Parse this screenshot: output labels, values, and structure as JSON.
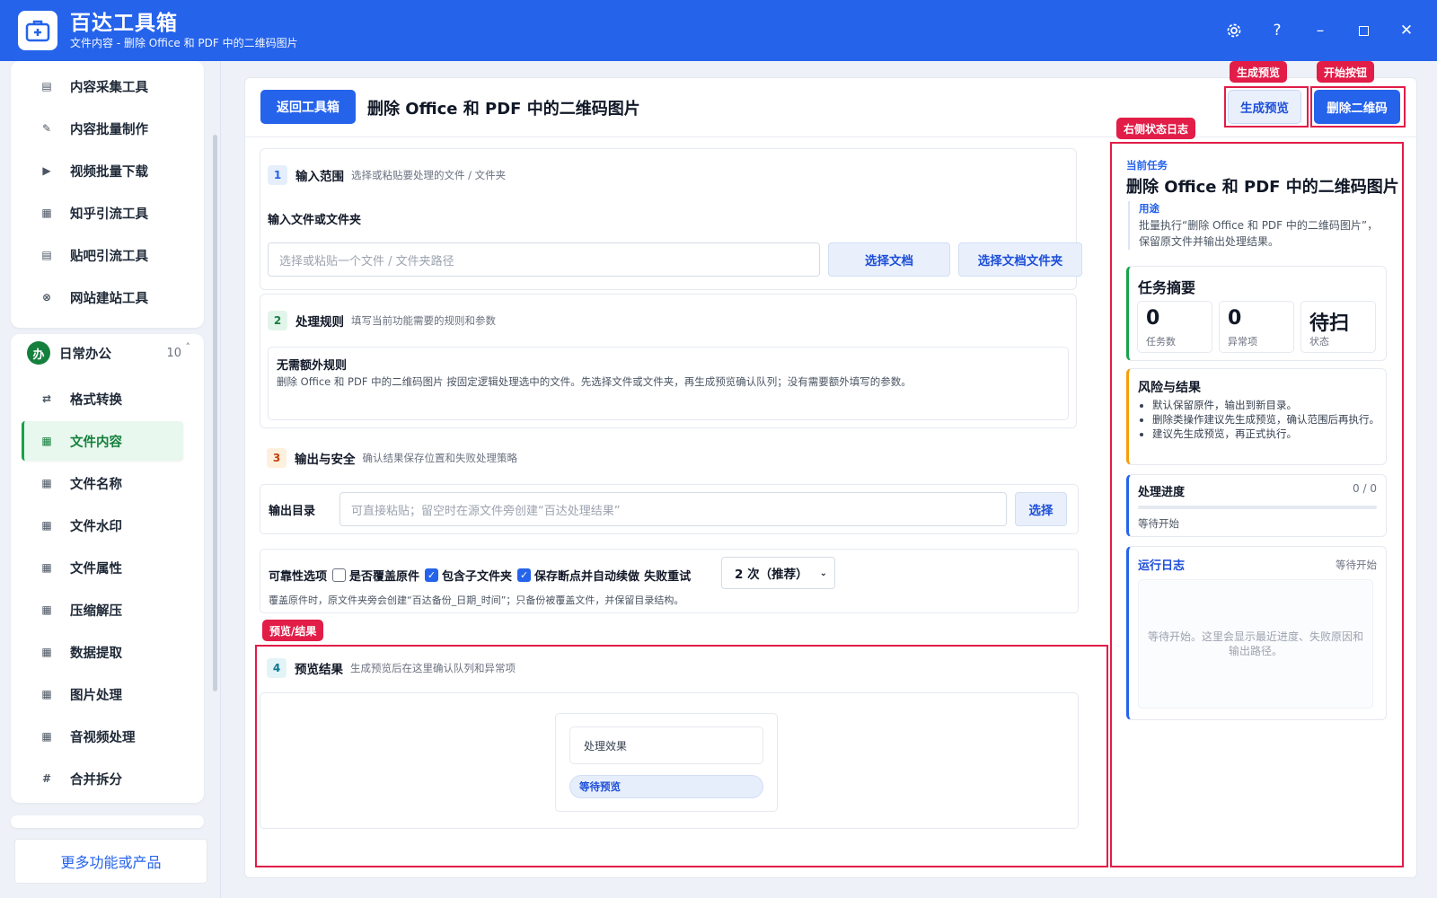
{
  "app": {
    "name": "百达工具箱",
    "subtitle": "文件内容 - 删除 Office 和 PDF 中的二维码图片",
    "window_controls": [
      "settings-icon",
      "help-icon",
      "minimize-icon",
      "maximize-icon",
      "close-icon"
    ]
  },
  "sidebar": {
    "top_items": [
      {
        "label": "内容采集工具",
        "icon": "document-icon"
      },
      {
        "label": "内容批量制作",
        "icon": "pen-icon"
      },
      {
        "label": "视频批量下载",
        "icon": "video-icon"
      },
      {
        "label": "知乎引流工具",
        "icon": "zhihu-icon"
      },
      {
        "label": "贴吧引流工具",
        "icon": "tieba-icon"
      },
      {
        "label": "网站建站工具",
        "icon": "web-icon"
      }
    ],
    "group": {
      "badge": "办",
      "name": "日常办公",
      "count": "10",
      "caret": "˄"
    },
    "group_items": [
      {
        "label": "格式转换",
        "icon": "convert-icon"
      },
      {
        "label": "文件内容",
        "icon": "grid-icon"
      },
      {
        "label": "文件名称",
        "icon": "grid-icon"
      },
      {
        "label": "文件水印",
        "icon": "grid-icon"
      },
      {
        "label": "文件属性",
        "icon": "grid-icon"
      },
      {
        "label": "压缩解压",
        "icon": "grid-icon"
      },
      {
        "label": "数据提取",
        "icon": "grid-icon"
      },
      {
        "label": "图片处理",
        "icon": "grid-icon"
      },
      {
        "label": "音视频处理",
        "icon": "grid-icon"
      },
      {
        "label": "合并拆分",
        "icon": "hash-icon"
      }
    ],
    "active_item": "文件内容",
    "more": "更多功能或产品"
  },
  "header": {
    "back": "返回工具箱",
    "title": "删除 Office 和 PDF 中的二维码图片",
    "preview": "生成预览",
    "start": "删除二维码"
  },
  "section1": {
    "num": "1",
    "title": "输入范围",
    "desc": "选择或粘贴要处理的文件 / 文件夹",
    "label": "输入文件或文件夹",
    "placeholder": "选择或粘贴一个文件 / 文件夹路径",
    "btn_file": "选择文档",
    "btn_folder": "选择文档文件夹"
  },
  "section2": {
    "num": "2",
    "title": "处理规则",
    "desc": "填写当前功能需要的规则和参数",
    "rule_title": "无需额外规则",
    "rule_desc": "删除 Office 和 PDF 中的二维码图片 按固定逻辑处理选中的文件。先选择文件或文件夹，再生成预览确认队列；没有需要额外填写的参数。"
  },
  "section3": {
    "num": "3",
    "title": "输出与安全",
    "desc": "确认结果保存位置和失败处理策略",
    "output_label": "输出目录",
    "output_placeholder": "可直接粘贴；留空时在源文件旁创建“百达处理结果”",
    "output_btn": "选择",
    "reliability_label": "可靠性选项",
    "overwrite": {
      "label": "是否覆盖原件",
      "checked": false
    },
    "subfolders": {
      "label": "包含子文件夹",
      "checked": true
    },
    "resume": {
      "label": "保存断点并自动续做",
      "checked": true
    },
    "retry_label": "失败重试",
    "retry_value": "2 次（推荐）",
    "note": "覆盖原件时，原文件夹旁会创建“百达备份_日期_时间”；只备份被覆盖文件，并保留目录结构。"
  },
  "section4": {
    "num": "4",
    "title": "预览结果",
    "desc": "生成预览后在这里确认队列和异常项",
    "effect_label": "处理效果",
    "status": "等待预览"
  },
  "right_panel": {
    "current_task_label": "当前任务",
    "task_title": "删除 Office 和 PDF 中的二维码图片",
    "purpose_label": "用途",
    "purpose_text": "批量执行“删除 Office 和 PDF 中的二维码图片”，保留原文件并输出处理结果。",
    "summary_title": "任务摘要",
    "stats": [
      {
        "value": "0",
        "label": "任务数"
      },
      {
        "value": "0",
        "label": "异常项"
      },
      {
        "value": "待扫",
        "label": "状态"
      }
    ],
    "risk_title": "风险与结果",
    "risks": [
      "默认保留原件，输出到新目录。",
      "删除类操作建议先生成预览，确认范围后再执行。",
      "建议先生成预览，再正式执行。"
    ],
    "progress_title": "处理进度",
    "progress_count": "0 / 0",
    "progress_value": 0,
    "progress_status": "等待开始",
    "log_title": "运行日志",
    "log_status": "等待开始",
    "log_placeholder": "等待开始。这里会显示最近进度、失败原因和输出路径。"
  },
  "annotations": {
    "preview": "生成预览",
    "start": "开始按钮",
    "log": "右侧状态日志",
    "result": "预览/结果"
  },
  "colors": {
    "primary": "#2563eb",
    "annotation": "#e11d48",
    "active_green": "#15803d"
  }
}
